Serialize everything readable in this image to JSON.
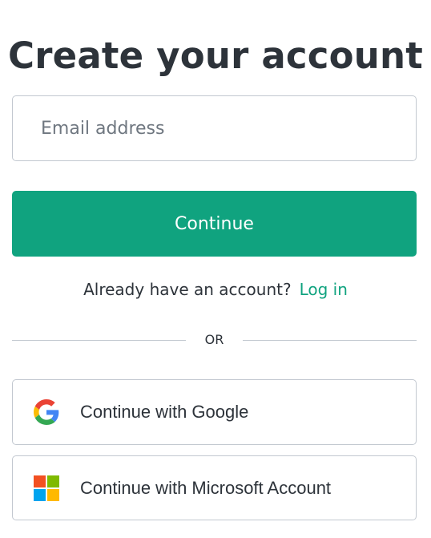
{
  "page": {
    "title": "Create your account"
  },
  "form": {
    "email_placeholder": "Email address",
    "email_value": "",
    "continue_label": "Continue"
  },
  "login": {
    "prompt": "Already have an account?",
    "link_label": "Log in"
  },
  "divider": {
    "label": "OR"
  },
  "social": [
    {
      "label": "Continue with Google",
      "icon": "google-logo-icon"
    },
    {
      "label": "Continue with Microsoft Account",
      "icon": "microsoft-logo-icon"
    }
  ],
  "colors": {
    "accent": "#10a37f",
    "text": "#2d333a",
    "border": "#c2c8d0",
    "placeholder": "#6f7780"
  }
}
